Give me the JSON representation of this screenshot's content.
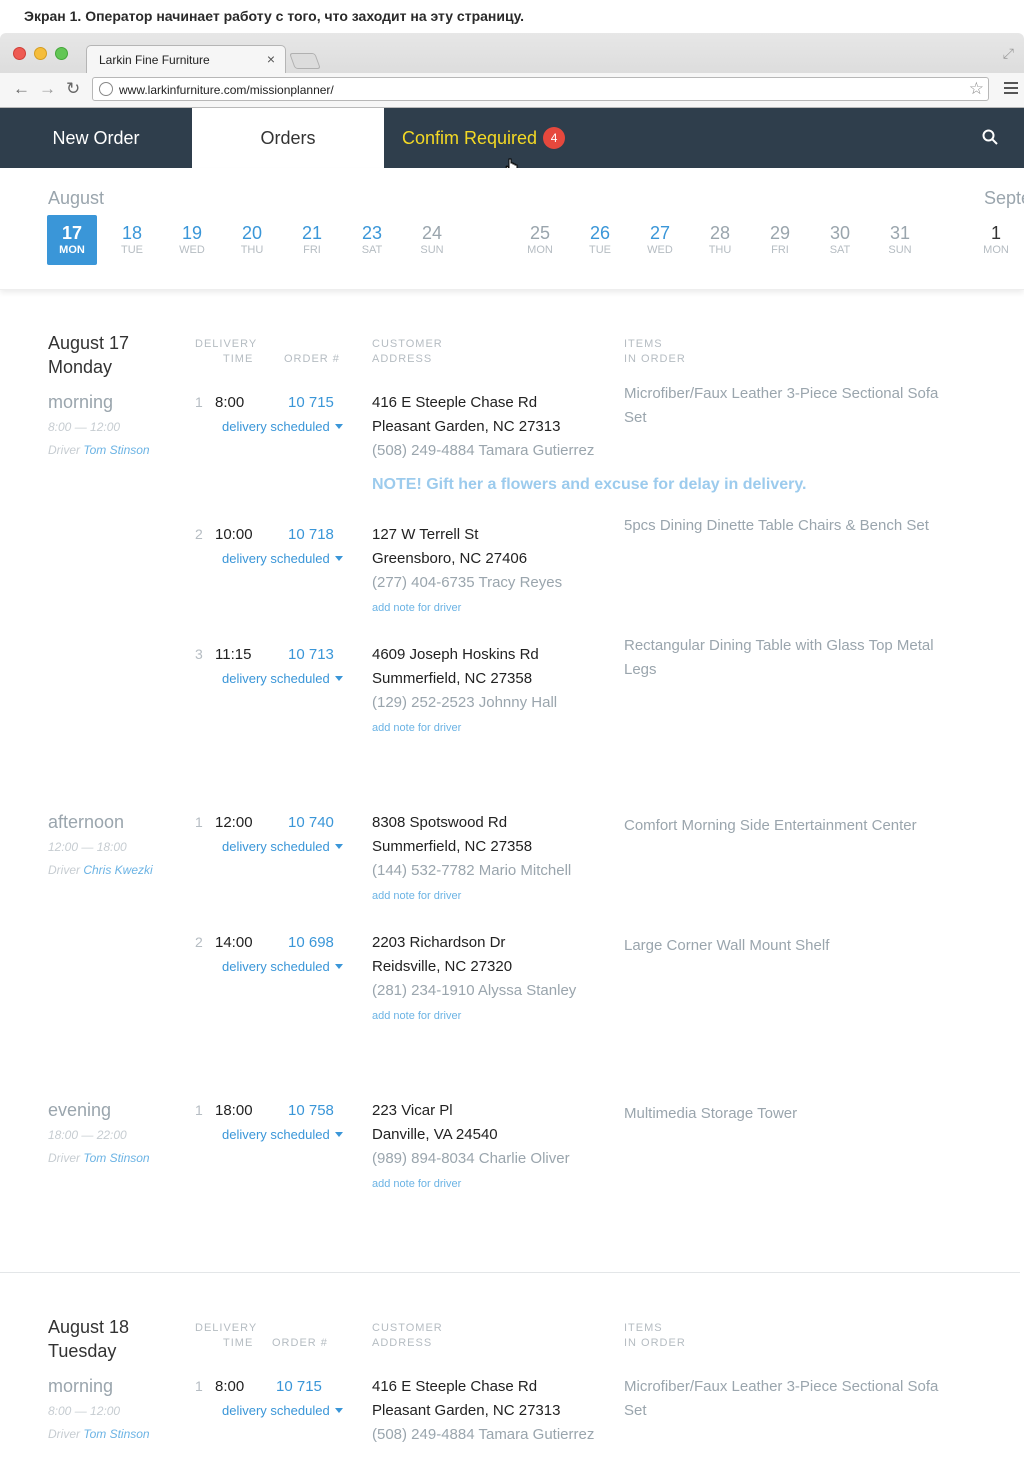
{
  "caption": "Экран 1. Оператор начинает работу с того, что заходит на эту страницу.",
  "browser": {
    "tab_title": "Larkin Fine Furniture",
    "tab_close": "×",
    "url": "www.larkinfurniture.com/missionplanner/"
  },
  "nav": {
    "new_order": "New Order",
    "orders": "Orders",
    "confirm_required": "Confim Required",
    "confirm_count": "4"
  },
  "dates": {
    "month1": "August",
    "month2": "Septe",
    "days": [
      {
        "num": "17",
        "dow": "MON"
      },
      {
        "num": "18",
        "dow": "TUE"
      },
      {
        "num": "19",
        "dow": "WED"
      },
      {
        "num": "20",
        "dow": "THU"
      },
      {
        "num": "21",
        "dow": "FRI"
      },
      {
        "num": "23",
        "dow": "SAT"
      },
      {
        "num": "24",
        "dow": "SUN"
      },
      {
        "num": "25",
        "dow": "MON"
      },
      {
        "num": "26",
        "dow": "TUE"
      },
      {
        "num": "27",
        "dow": "WED"
      },
      {
        "num": "28",
        "dow": "THU"
      },
      {
        "num": "29",
        "dow": "FRI"
      },
      {
        "num": "30",
        "dow": "SAT"
      },
      {
        "num": "31",
        "dow": "SUN"
      },
      {
        "num": "1",
        "dow": "MON"
      }
    ]
  },
  "columns": {
    "delivery_1": "DELIVERY",
    "delivery_2": "TIME",
    "order": "ORDER #",
    "customer_1": "CUSTOMER",
    "customer_2": "ADDRESS",
    "items_1": "ITEMS",
    "items_2": "IN ORDER"
  },
  "day1": {
    "date": "August 17",
    "weekday": "Monday",
    "periods": [
      {
        "name": "morning",
        "range": "8:00 — 12:00",
        "driver_prefix": "Driver ",
        "driver": "Tom Stinson"
      },
      {
        "name": "afternoon",
        "range": "12:00 — 18:00",
        "driver_prefix": "Driver ",
        "driver": "Chris Kwezki"
      },
      {
        "name": "evening",
        "range": "18:00 — 22:00",
        "driver_prefix": "Driver ",
        "driver": "Tom Stinson"
      }
    ],
    "orders": [
      {
        "idx": "1",
        "time": "8:00",
        "num": "10 715",
        "status": "delivery scheduled",
        "addr1": "416 E Steeple Chase Rd",
        "addr2": "Pleasant Garden, NC 27313",
        "contact": "(508) 249-4884 Tamara Gutierrez",
        "note": "NOTE! Gift her a flowers and excuse for delay in delivery.",
        "items": "Microfiber/Faux Leather 3-Piece Sectional Sofa Set"
      },
      {
        "idx": "2",
        "time": "10:00",
        "num": "10 718",
        "status": "delivery scheduled",
        "addr1": "127 W Terrell St",
        "addr2": "Greensboro, NC 27406",
        "contact": "(277) 404-6735 Tracy Reyes",
        "addnote": "add note for driver",
        "items": "5pcs Dining Dinette Table Chairs & Bench Set"
      },
      {
        "idx": "3",
        "time": "11:15",
        "num": "10 713",
        "status": "delivery scheduled",
        "addr1": "4609 Joseph Hoskins Rd",
        "addr2": "Summerfield, NC 27358",
        "contact": "(129) 252-2523 Johnny Hall",
        "addnote": "add note for driver",
        "items": "Rectangular Dining Table with Glass Top Metal Legs"
      },
      {
        "idx": "1",
        "time": "12:00",
        "num": "10 740",
        "status": "delivery scheduled",
        "addr1": "8308 Spotswood Rd",
        "addr2": "Summerfield, NC 27358",
        "contact": "(144) 532-7782 Mario Mitchell",
        "addnote": "add note for driver",
        "items": "Comfort Morning Side Entertainment Center"
      },
      {
        "idx": "2",
        "time": "14:00",
        "num": "10 698",
        "status": "delivery scheduled",
        "addr1": "2203 Richardson Dr",
        "addr2": "Reidsville, NC 27320",
        "contact": "(281) 234-1910 Alyssa Stanley",
        "addnote": "add note for driver",
        "items": "Large Corner Wall Mount Shelf"
      },
      {
        "idx": "1",
        "time": "18:00",
        "num": "10 758",
        "status": "delivery scheduled",
        "addr1": "223 Vicar Pl",
        "addr2": "Danville, VA 24540",
        "contact": "(989) 894-8034 Charlie Oliver",
        "addnote": "add note for driver",
        "items": "Multimedia Storage Tower"
      }
    ]
  },
  "day2": {
    "date": "August 18",
    "weekday": "Tuesday",
    "periods": [
      {
        "name": "morning",
        "range": "8:00 — 12:00",
        "driver_prefix": "Driver ",
        "driver": "Tom Stinson"
      }
    ],
    "orders": [
      {
        "idx": "1",
        "time": "8:00",
        "num": "10 715",
        "status": "delivery scheduled",
        "addr1": "416 E Steeple Chase Rd",
        "addr2": "Pleasant Garden, NC 27313",
        "contact": "(508) 249-4884 Tamara Gutierrez",
        "items": "Microfiber/Faux Leather 3-Piece Sectional Sofa Set"
      }
    ]
  }
}
